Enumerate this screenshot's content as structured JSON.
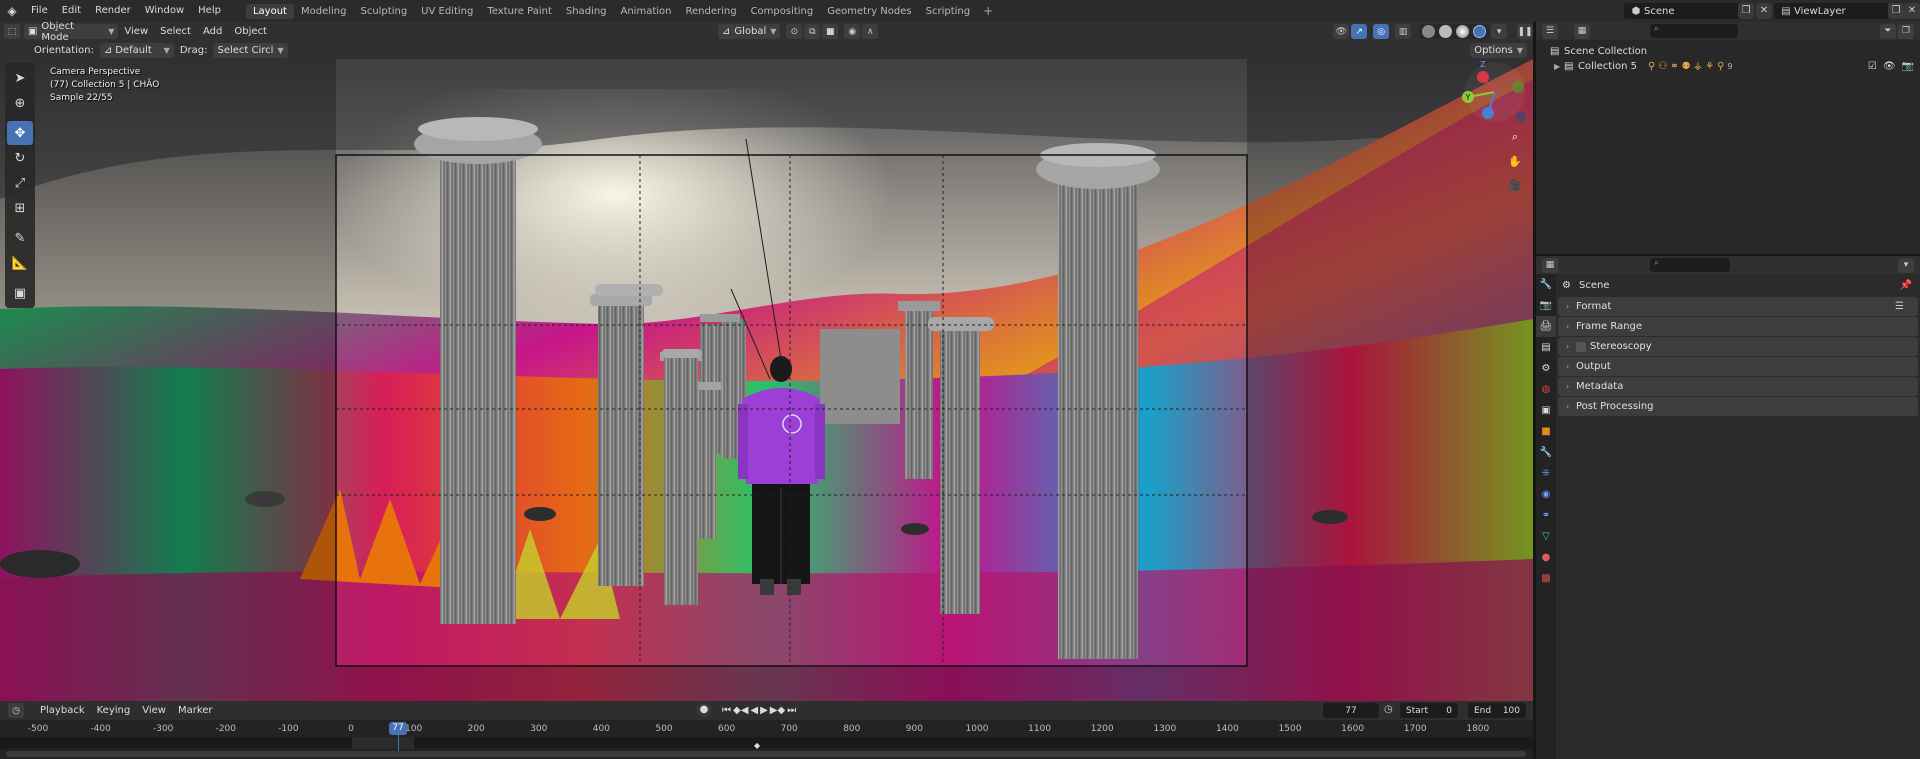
{
  "menu": {
    "items": [
      "File",
      "Edit",
      "Render",
      "Window",
      "Help"
    ]
  },
  "workspaces": {
    "active": "Layout",
    "tabs": [
      "Layout",
      "Modeling",
      "Sculpting",
      "UV Editing",
      "Texture Paint",
      "Shading",
      "Animation",
      "Rendering",
      "Compositing",
      "Geometry Nodes",
      "Scripting"
    ]
  },
  "scene": {
    "name": "Scene"
  },
  "view_layer": {
    "name": "ViewLayer"
  },
  "viewport_header": {
    "mode": "Object Mode",
    "menus": [
      "View",
      "Select",
      "Add",
      "Object"
    ],
    "transform_orientation": "Global",
    "orientation_label": "Orientation:",
    "orientation_value": "Default",
    "drag_label": "Drag:",
    "drag_value": "Select Circl",
    "options": "Options"
  },
  "viewport": {
    "line1": "Camera Perspective",
    "line2": "(77) Collection 5 | CHÃO",
    "line3": "Sample 22/55",
    "gizmo": {
      "x": "X",
      "y": "Y",
      "z": "Z"
    },
    "colors": {
      "sky_top": "#3f3f42",
      "sky_bright": "#e8e3d6",
      "grass_magenta": "#c2188a",
      "grass_green": "#1fbf6a",
      "grass_orange": "#e8720c",
      "column": "#9a9a9a",
      "jacket": "#9b3fd6"
    }
  },
  "outliner": {
    "root": "Scene Collection",
    "items": [
      {
        "label": "Collection 5"
      }
    ],
    "count_badge": "9"
  },
  "properties": {
    "context_title": "Scene",
    "panels": [
      "Format",
      "Frame Range",
      "Stereoscopy",
      "Output",
      "Metadata",
      "Post Processing"
    ]
  },
  "timeline": {
    "menus": [
      "Playback",
      "Keying",
      "View",
      "Marker"
    ],
    "current_frame": "77",
    "start_label": "Start",
    "start": "0",
    "end_label": "End",
    "end": "100",
    "playhead": "77",
    "ticks": [
      "-500",
      "-400",
      "-300",
      "-200",
      "-100",
      "0",
      "100",
      "200",
      "300",
      "400",
      "500",
      "600",
      "700",
      "800",
      "900",
      "1000",
      "1100",
      "1200",
      "1300",
      "1400",
      "1500",
      "1600",
      "1700",
      "1800"
    ]
  }
}
